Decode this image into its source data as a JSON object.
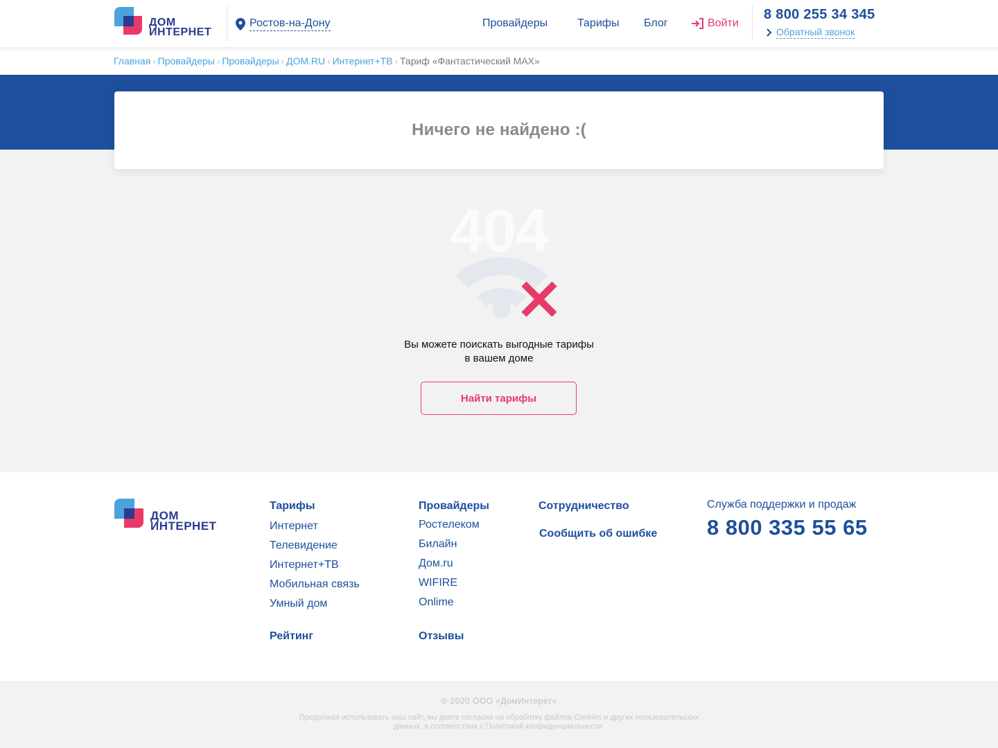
{
  "header": {
    "logo_line1": "ДОМ",
    "logo_line2": "ИНТЕРНЕТ",
    "city": "Ростов-на-Дону",
    "nav": [
      "Провайдеры",
      "Тарифы",
      "Блог"
    ],
    "login": "Войти",
    "phone": "8 800 255 34 345",
    "callback": "Обратный звонок"
  },
  "breadcrumbs": [
    {
      "label": "Главная",
      "current": false
    },
    {
      "label": "Провайдеры",
      "current": false
    },
    {
      "label": "Провайдеры",
      "current": false
    },
    {
      "label": "ДОМ.RU",
      "current": false
    },
    {
      "label": "Интернет+ТВ",
      "current": false
    },
    {
      "label": "Тариф «Фантастический MAX»",
      "current": true
    }
  ],
  "main": {
    "title": "Ничего не найдено :(",
    "error_code": "404",
    "message_line1": "Вы можете поискать выгодные тарифы",
    "message_line2": "в вашем доме",
    "button": "Найти тарифы"
  },
  "footer": {
    "logo_line1": "ДОМ",
    "logo_line2": "ИНТЕРНЕТ",
    "tariffs": {
      "heading": "Тарифы",
      "links": [
        "Интернет",
        "Телевидение",
        "Интернет+ТВ",
        "Мобильная связь",
        "Умный дом"
      ]
    },
    "rating": "Рейтинг",
    "providers": {
      "heading": "Провайдеры",
      "links": [
        "Ростелеком",
        "Билайн",
        "Дом.ru",
        "WIFIRE",
        "Onlime"
      ]
    },
    "reviews": "Отзывы",
    "cooperation": "Сотрудничество",
    "report_error": "Сообщить об ошибке",
    "support_title": "Служба поддержки и продаж",
    "support_phone": "8 800 335 55 65"
  },
  "bottom": {
    "copyright": "© 2020 ООО «ДомИнтерет»",
    "cookies": "Продолжая использовать наш сайт, вы даете согласие на обработку файлов Cookies и других пользовательских данных, в соответствии с Политикой конфиденциальности."
  },
  "colors": {
    "brand_blue": "#1d4f9c",
    "accent_pink": "#e83a68",
    "light_blue": "#4aa3dc",
    "logo_navy": "#2a3b8f",
    "page_bg": "#f2f2f2"
  },
  "icons": [
    "map-pin-icon",
    "login-icon",
    "chevron-right-icon",
    "wifi-off-icon"
  ]
}
